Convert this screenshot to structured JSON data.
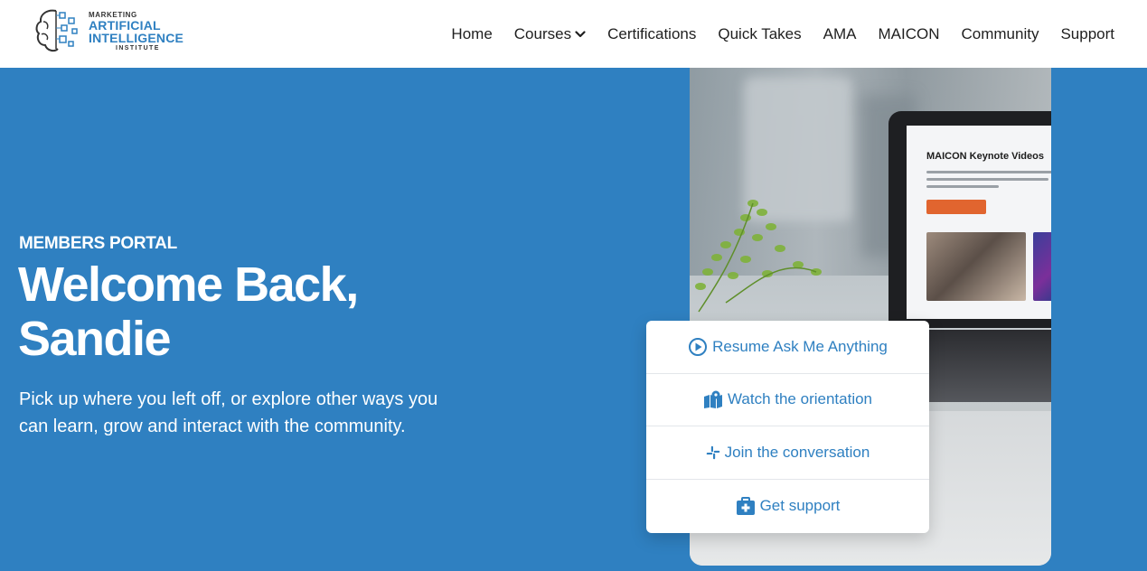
{
  "brand": {
    "line1": "MARKETING",
    "line2": "ARTIFICIAL",
    "line3": "INTELLIGENCE",
    "line4": "INSTITUTE"
  },
  "nav": {
    "items": [
      "Home",
      "Courses",
      "Certifications",
      "Quick Takes",
      "AMA",
      "MAICON",
      "Community",
      "Support"
    ]
  },
  "hero": {
    "eyebrow": "MEMBERS PORTAL",
    "headline": "Welcome Back, Sandie",
    "subtext": "Pick up where you left off, or explore other ways you can learn, grow and interact with the community."
  },
  "screen": {
    "title": "MAICON Keynote Videos"
  },
  "quick_links": [
    {
      "label": "Resume Ask Me Anything",
      "icon": "play-circle-icon"
    },
    {
      "label": "Watch the orientation",
      "icon": "map-pin-icon"
    },
    {
      "label": "Join the conversation",
      "icon": "slack-icon"
    },
    {
      "label": "Get support",
      "icon": "first-aid-kit-icon"
    }
  ],
  "colors": {
    "accent": "#2f80c1",
    "hero_bg": "#2f80c1",
    "cta_orange": "#e1652f"
  }
}
